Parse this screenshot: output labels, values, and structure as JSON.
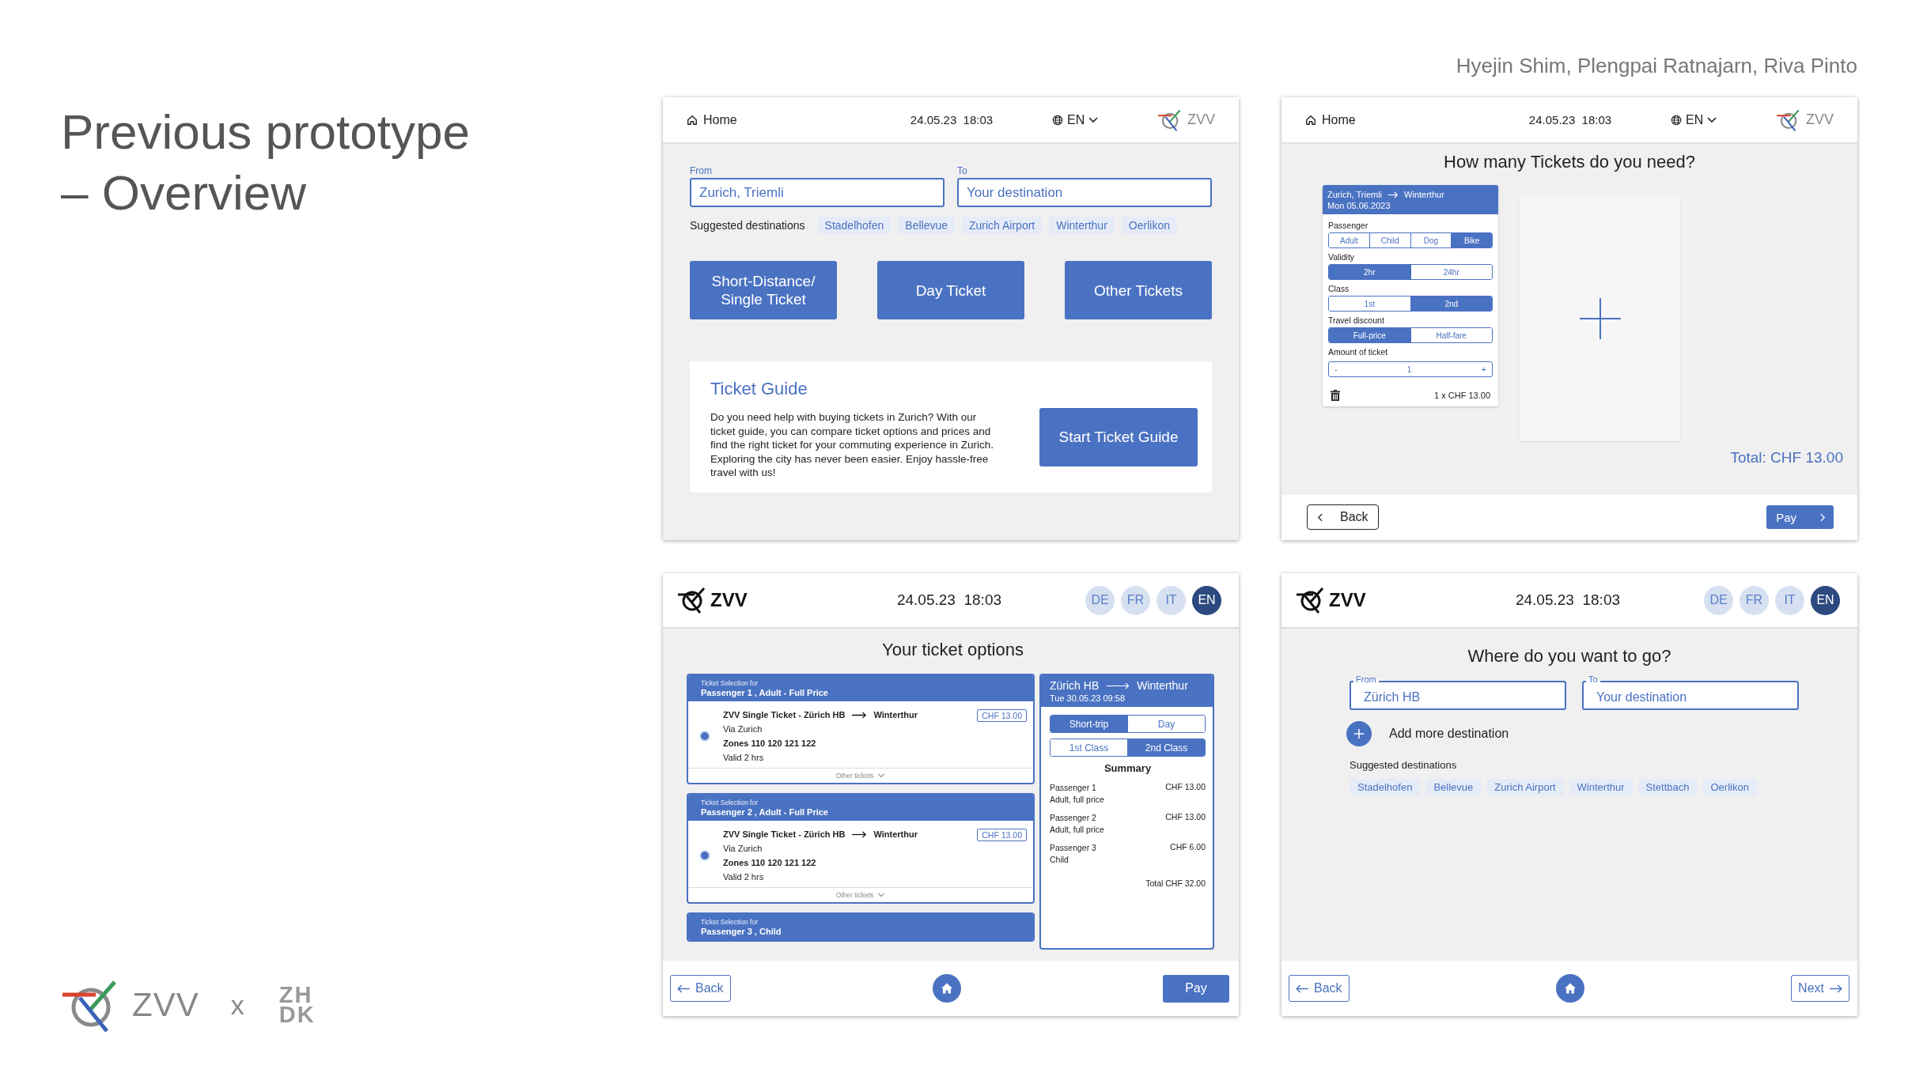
{
  "slide": {
    "title": "Previous prototype – Overview",
    "authors": "Hyejin Shim, Plengpai Ratnajarn, Riva Pinto",
    "logo": "ZVV",
    "separator": "x",
    "partner_logo": [
      "ZH",
      "DK"
    ]
  },
  "screens": [
    {
      "kind": "home",
      "header": {
        "home": "Home",
        "datetime": "24.05.23  18:03",
        "language": "EN",
        "logo": "ZVV"
      },
      "from": {
        "label": "From",
        "value": "Zurich, Triemli"
      },
      "to": {
        "label": "To",
        "placeholder": "Your destination"
      },
      "suggested_label": "Suggested destinations",
      "suggestions": [
        "Stadelhofen",
        "Bellevue",
        "Zurich Airport",
        "Winterthur",
        "Oerlikon"
      ],
      "ticket_buttons": [
        "Short-Distance/ Single Ticket",
        "Day Ticket",
        "Other Tickets"
      ],
      "guide": {
        "title": "Ticket Guide",
        "text": "Do you need help with buying tickets in Zurich? With our ticket guide, you can compare ticket options and prices and find the right ticket for your commuting experience in Zurich. Exploring the city has never been easier. Enjoy hassle-free  travel with us!",
        "button": "Start Ticket Guide"
      }
    },
    {
      "kind": "tickets",
      "header": {
        "home": "Home",
        "datetime": "24.05.23  18:03",
        "language": "EN",
        "logo": "ZVV"
      },
      "question": "How many Tickets do you need?",
      "card": {
        "from": "Zurich, Triemli",
        "to": "Winterthur",
        "date": "Mon 05.06.2023",
        "groups": [
          {
            "label": "Passenger",
            "options": [
              {
                "label": "Adult",
                "selected": false
              },
              {
                "label": "Child",
                "selected": false
              },
              {
                "label": "Dog",
                "selected": false
              },
              {
                "label": "Bike",
                "selected": true
              }
            ]
          },
          {
            "label": "Validity",
            "options": [
              {
                "label": "2hr",
                "selected": true
              },
              {
                "label": "24hr",
                "selected": false
              }
            ]
          },
          {
            "label": "Class",
            "options": [
              {
                "label": "1st",
                "selected": false
              },
              {
                "label": "2nd",
                "selected": true
              }
            ]
          },
          {
            "label": "Travel discount",
            "options": [
              {
                "label": "Full-price",
                "selected": true
              },
              {
                "label": "Half-fare",
                "selected": false
              }
            ]
          }
        ],
        "amount_label": "Amount of ticket",
        "minus": "-",
        "amount": "1",
        "plus": "+",
        "price": "1 x CHF 13.00"
      },
      "total": "Total: CHF 13.00",
      "back": "Back",
      "pay": "Pay"
    },
    {
      "kind": "options",
      "header": {
        "logo": "ZVV",
        "datetime": "24.05.23  18:03",
        "languages": [
          {
            "label": "DE",
            "selected": false
          },
          {
            "label": "FR",
            "selected": false
          },
          {
            "label": "IT",
            "selected": false
          },
          {
            "label": "EN",
            "selected": true
          }
        ]
      },
      "title": "Your ticket options",
      "passengers": [
        {
          "caption": "Ticket Selection for",
          "name": "Passenger 1 , Adult - Full Price",
          "ticket": "ZVV Single Ticket  - Zürich HB",
          "destination": "Winterthur",
          "via": "Via Zurich",
          "zones": "Zones 110 120 121 122",
          "valid": "Valid 2 hrs",
          "price": "CHF 13.00",
          "selected": true,
          "more": "Other tickets"
        },
        {
          "caption": "Ticket Selection for",
          "name": "Passenger 2 , Adult - Full Price",
          "ticket": "ZVV Single Ticket  - Zürich HB",
          "destination": "Winterthur",
          "via": "Via Zurich",
          "zones": "Zones 110 120 121 122",
          "valid": "Valid 2 hrs",
          "price": "CHF 13.00",
          "selected": true,
          "more": "Other tickets"
        },
        {
          "caption": "Ticket Selection for",
          "name": "Passenger 3 , Child"
        }
      ],
      "summary": {
        "from": "Zürich HB",
        "to": "Winterthur",
        "date": "Tue 30.05.23  09:58",
        "trip": [
          {
            "label": "Short-trip",
            "selected": true
          },
          {
            "label": "Day",
            "selected": false
          }
        ],
        "class": [
          {
            "label": "1st Class",
            "selected": false
          },
          {
            "label": "2nd Class",
            "selected": true
          }
        ],
        "title": "Summary",
        "lines": [
          {
            "name": "Passenger 1",
            "detail": "Adult, full price",
            "price": "CHF 13.00"
          },
          {
            "name": "Passenger 2",
            "detail": "Adult, full price",
            "price": "CHF 13.00"
          },
          {
            "name": "Passenger 3",
            "detail": "Child",
            "price": "CHF 6.00"
          }
        ],
        "total": "Total CHF 32.00"
      },
      "back": "Back",
      "pay": "Pay"
    },
    {
      "kind": "destination",
      "header": {
        "logo": "ZVV",
        "datetime": "24.05.23  18:03",
        "languages": [
          {
            "label": "DE",
            "selected": false
          },
          {
            "label": "FR",
            "selected": false
          },
          {
            "label": "IT",
            "selected": false
          },
          {
            "label": "EN",
            "selected": true
          }
        ]
      },
      "title": "Where do you want to go?",
      "from": {
        "label": "From",
        "value": "Zürich HB"
      },
      "to": {
        "label": "To",
        "placeholder": "Your destination"
      },
      "add": "Add more destination",
      "suggested_label": "Suggested destinations",
      "suggestions": [
        "Stadelhofen",
        "Bellevue",
        "Zurich Airport",
        "Winterthur",
        "Stettbach",
        "Oerlikon"
      ],
      "back": "Back",
      "next": "Next"
    }
  ]
}
